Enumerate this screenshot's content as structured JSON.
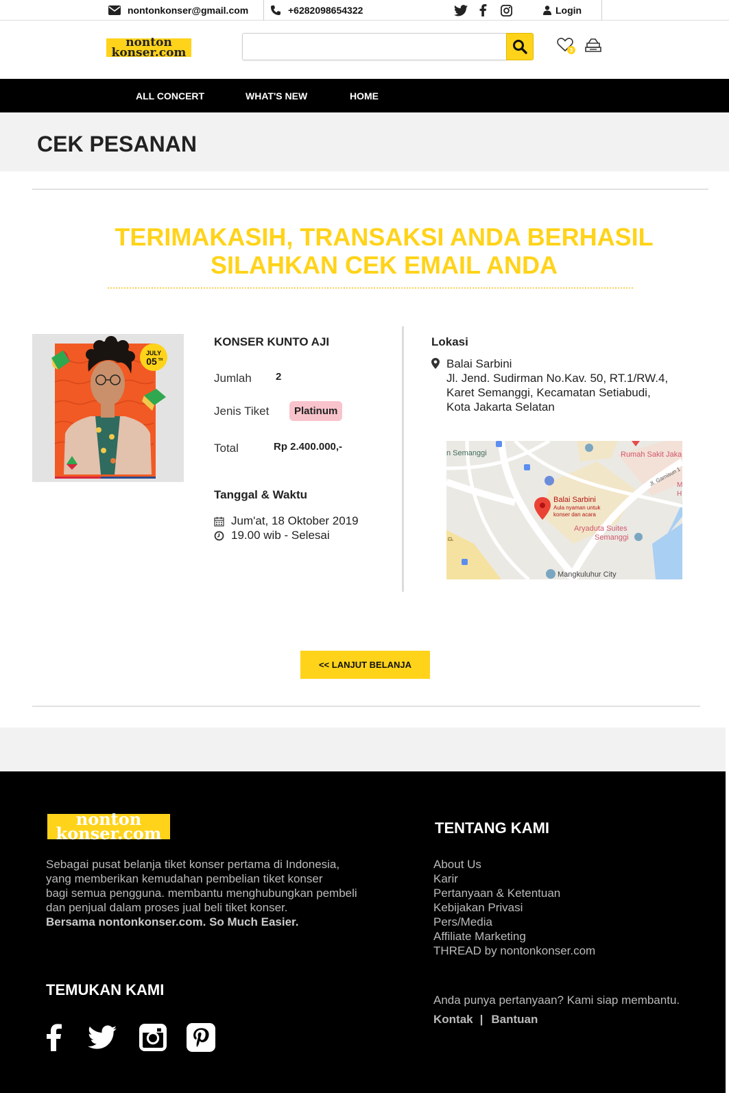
{
  "topbar": {
    "email": "nontonkonser@gmail.com",
    "phone": "+6282098654322",
    "login_label": "Login",
    "icons": [
      "mail-icon",
      "phone-icon",
      "twitter-icon",
      "facebook-icon",
      "instagram-icon",
      "user-icon"
    ]
  },
  "header": {
    "logo_line1": "nonton",
    "logo_line2": "konser.com",
    "search_placeholder": "",
    "search_value": "",
    "wishlist_count": "3",
    "icons": [
      "search-icon",
      "heart-icon",
      "cart-icon"
    ]
  },
  "nav": {
    "items": [
      "ALL CONCERT",
      "WHAT'S NEW",
      "HOME"
    ]
  },
  "page_title": "CEK PESANAN",
  "thanks": {
    "line1": "TERIMAKASIH, TRANSAKSI ANDA BERHASIL",
    "line2": "SILAHKAN CEK EMAIL ANDA"
  },
  "order": {
    "poster_month": "JULY",
    "poster_day": "05",
    "poster_suffix": "TH",
    "concert_title": "KONSER KUNTO AJI",
    "jumlah_label": "Jumlah",
    "jumlah_value": "2",
    "jenis_label": "Jenis Tiket",
    "jenis_value": "Platinum",
    "total_label": "Total",
    "total_value": "Rp 2.400.000,-",
    "datetime_title": "Tanggal & Waktu",
    "date": "Jum'at, 18 Oktober 2019",
    "time": "19.00 wib - Selesai"
  },
  "location": {
    "title": "Lokasi",
    "venue": "Balai Sarbini",
    "address_line1": "Jl. Jend. Sudirman No.Kav. 50, RT.1/RW.4,",
    "address_line2": "Karet Semanggi, Kecamatan Setiabudi,",
    "address_line3": "Kota Jakarta Selatan",
    "map": {
      "label_semanggi": "n Semanggi",
      "label_rs": "Rumah Sakit Jaka",
      "label_garnisun": "Jl. Garnisun 1",
      "label_venue": "Balai Sarbini",
      "label_venue_sub1": "Aula nyaman untuk",
      "label_venue_sub2": "konser dan acara",
      "label_hotel1": "Aryaduta Suites",
      "label_hotel2": "Semanggi",
      "label_mall": "Mangkuluhur City",
      "label_m": "M",
      "label_h": "H",
      "label_d": "d"
    }
  },
  "cta_label": "<< LANJUT BELANJA",
  "footer": {
    "logo_line1": "nonton",
    "logo_line2": "konser.com",
    "desc_line1": "Sebagai pusat belanja tiket konser pertama di Indonesia,",
    "desc_line2": "yang memberikan kemudahan pembelian tiket konser",
    "desc_line3": "bagi semua pengguna. membantu menghubungkan pembeli",
    "desc_line4": "dan penjual dalam proses jual beli tiket konser.",
    "desc_strong": "Bersama nontonkonser.com. So Much Easier.",
    "about_title": "TENTANG KAMI",
    "links": [
      "About Us",
      "Karir",
      "Pertanyaan & Ketentuan",
      "Kebijakan Privasi",
      "Pers/Media",
      "Affiliate Marketing",
      "THREAD by nontonkonser.com"
    ],
    "find_title": "TEMUKAN KAMI",
    "question": "Anda punya pertanyaan? Kami siap membantu.",
    "contact": "Kontak",
    "separator": "|",
    "help": "Bantuan",
    "social_icons": [
      "facebook-icon",
      "twitter-icon",
      "instagram-icon",
      "pinterest-icon"
    ]
  },
  "colors": {
    "accent": "#ffd31a",
    "nav_bg": "#000000",
    "ticket_pill": "#f9c3cc",
    "band_bg": "#f2f2f2"
  }
}
